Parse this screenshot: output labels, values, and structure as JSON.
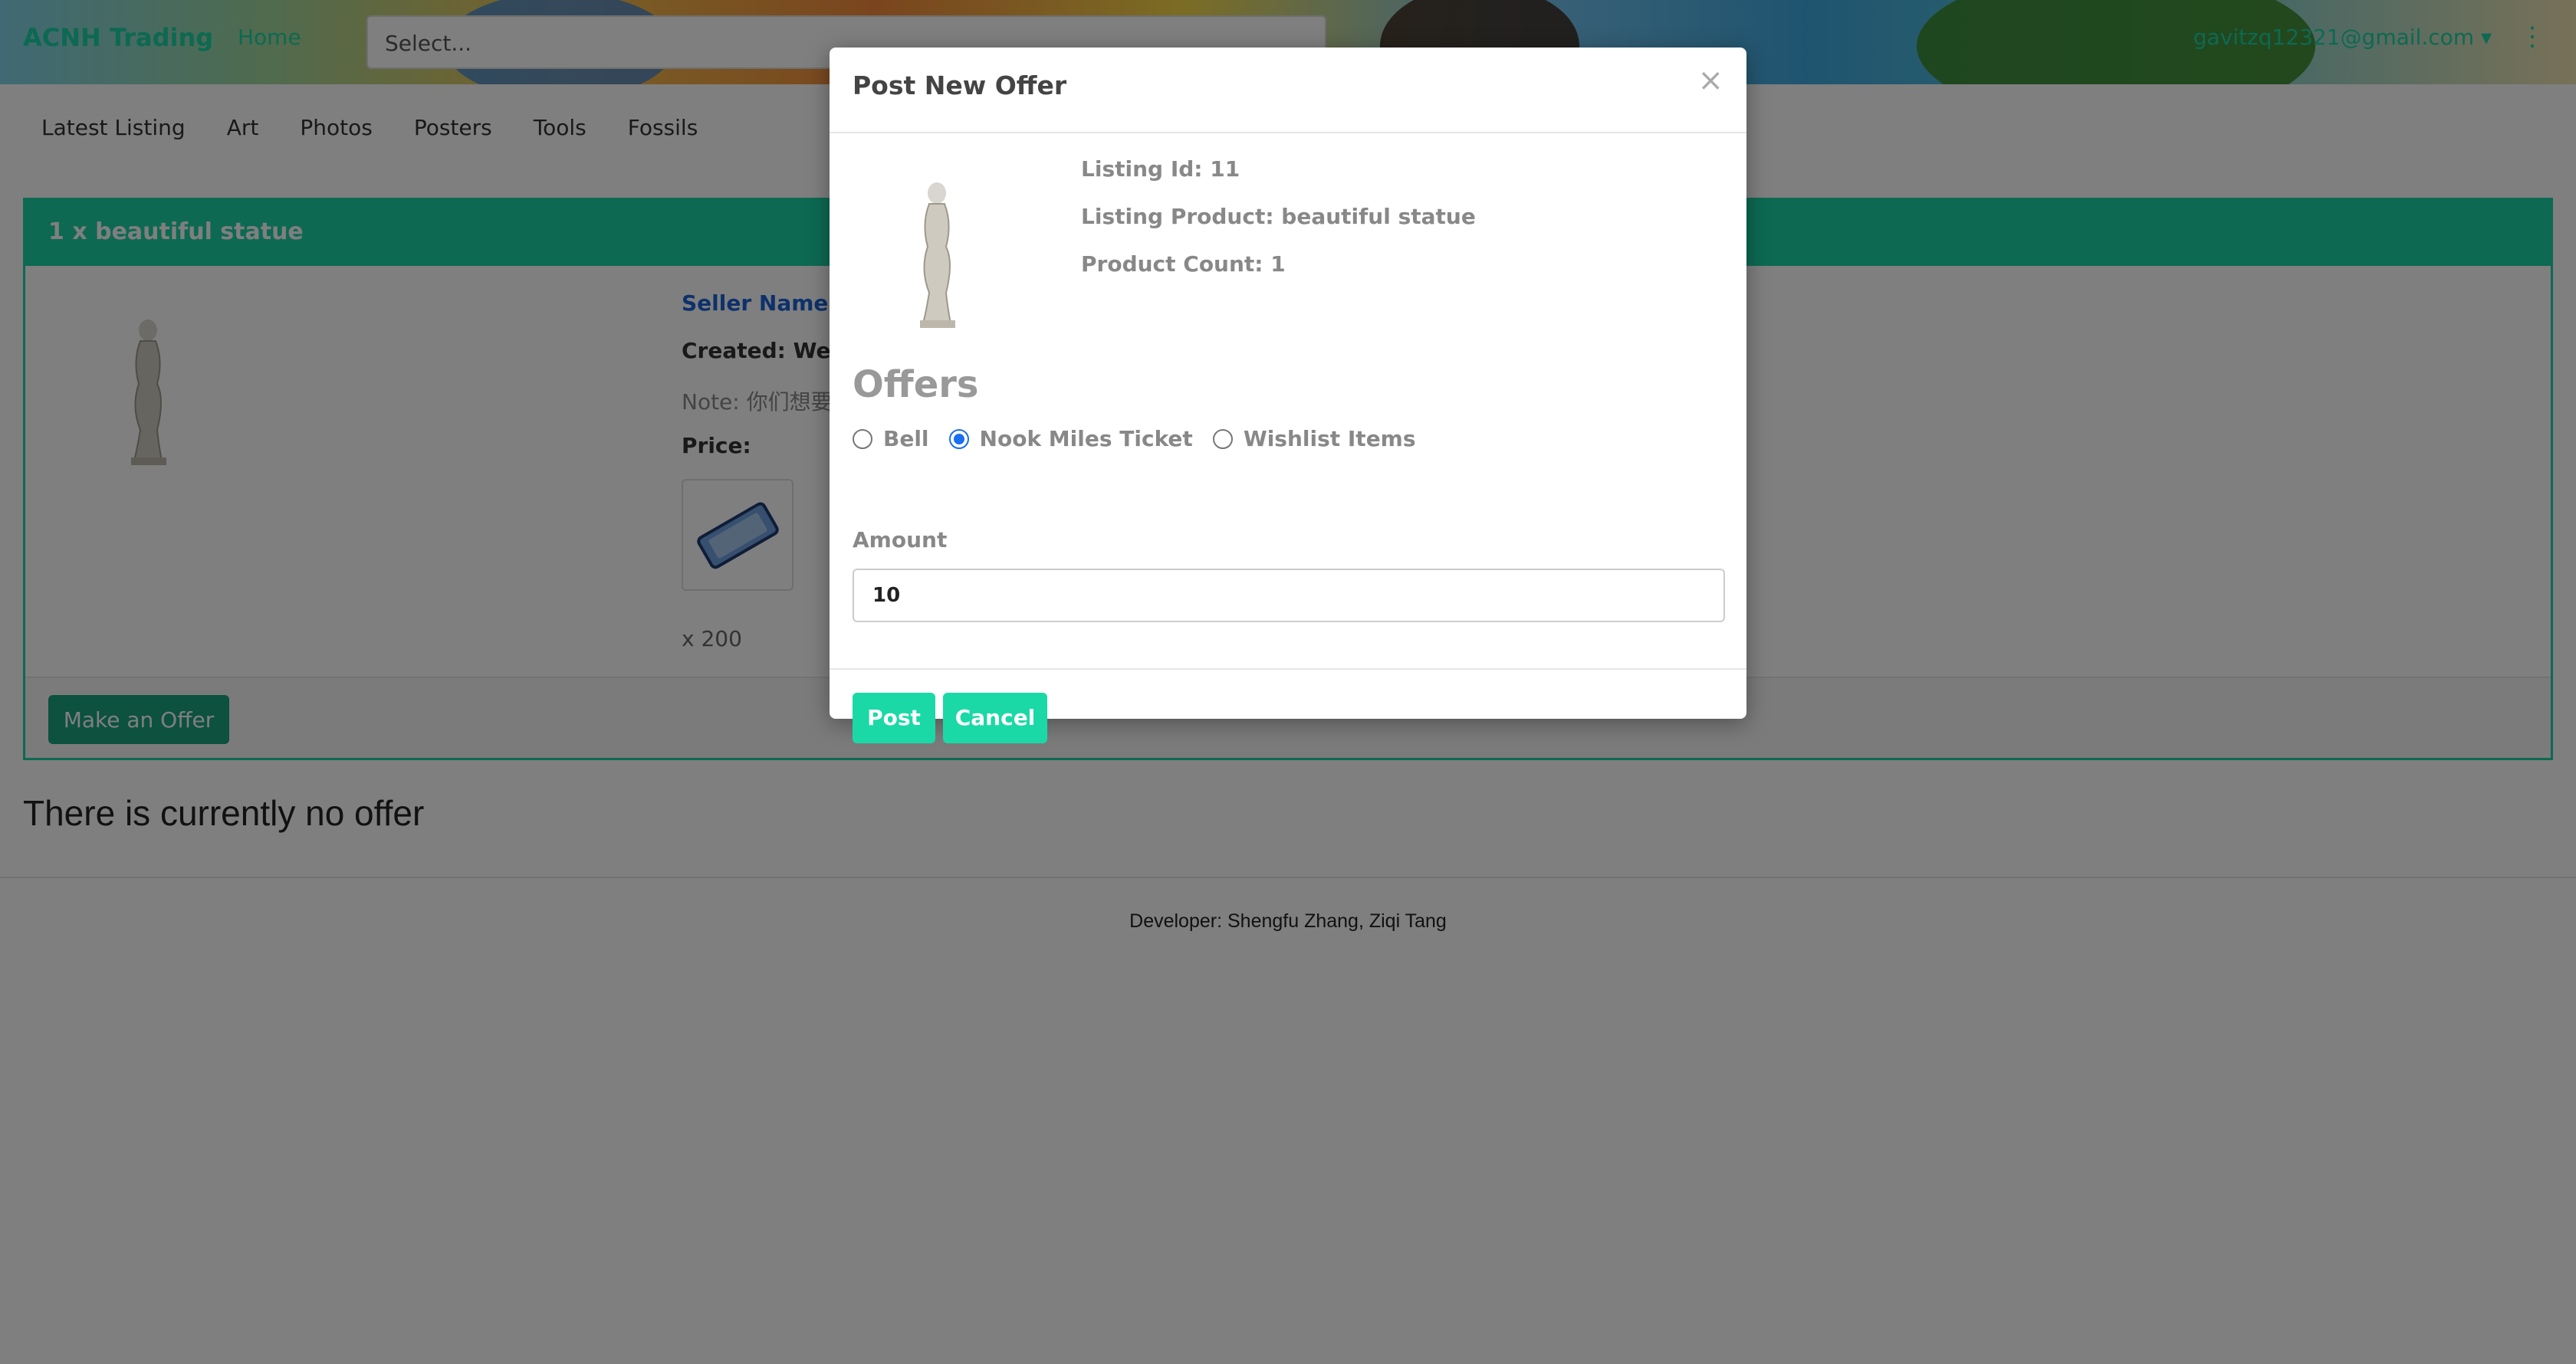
{
  "navbar": {
    "brand": "ACNH Trading",
    "link": "Home",
    "select_placeholder": "Select...",
    "user_email": "gavitzq12321@gmail.com",
    "user_caret": "▾",
    "kebab": "⋮"
  },
  "subnav": [
    "Latest Listing",
    "Art",
    "Photos",
    "Posters",
    "Tools",
    "Fossils"
  ],
  "listing": {
    "title": "1 x beautiful statue",
    "seller": "Seller Name: pp",
    "created": "Created: Wed A",
    "note_label": "Note: ",
    "note_value": "你们想要",
    "price_label": "Price:",
    "price_icon": "nook-miles-ticket-icon",
    "quantity": "x 200",
    "offer_button": "Make an Offer"
  },
  "no_offer": "There is currently no offer",
  "footer": "Developer: Shengfu Zhang, Ziqi Tang",
  "modal": {
    "title": "Post New Offer",
    "close": "×",
    "listing_id": "Listing Id: 11",
    "listing_product": "Listing Product: beautiful statue",
    "product_count": "Product Count: 1",
    "offers_heading": "Offers",
    "options": [
      {
        "label": "Bell",
        "checked": false
      },
      {
        "label": "Nook Miles Ticket",
        "checked": true
      },
      {
        "label": "Wishlist Items",
        "checked": false
      }
    ],
    "amount_label": "Amount",
    "amount_value": "10",
    "post_button": "Post",
    "cancel_button": "Cancel"
  },
  "colors": {
    "accent": "#1bd2a4",
    "radio": "#1a6ef0",
    "seller_link": "#1a62d6"
  }
}
